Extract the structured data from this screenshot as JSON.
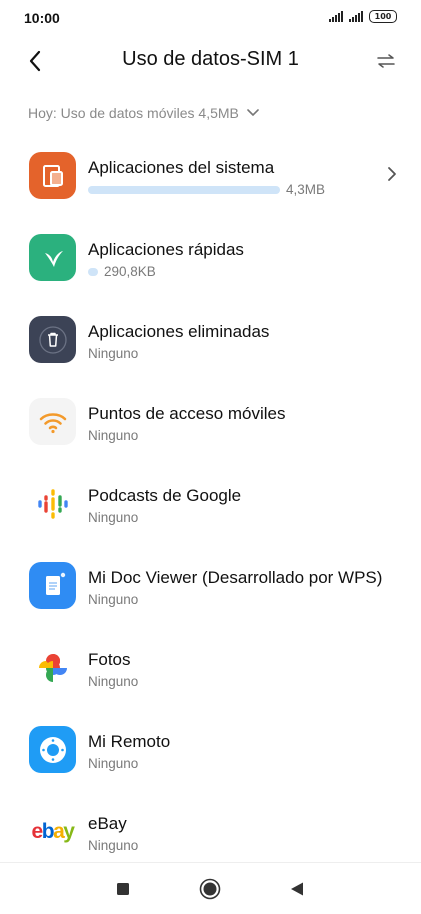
{
  "status_bar": {
    "time": "10:00",
    "battery": "100",
    "icons": [
      "signal-icon",
      "signal-icon",
      "battery-icon"
    ]
  },
  "header": {
    "title": "Uso de datos-SIM 1",
    "back_icon": "back-arrow-icon",
    "switch_icon": "switch-sim-icon"
  },
  "summary": {
    "text": "Hoy: Uso de datos móviles 4,5MB",
    "icon": "chevron-down-icon"
  },
  "apps": [
    {
      "name": "Aplicaciones del sistema",
      "usage": "4,3MB",
      "usage_fraction": 0.96,
      "icon": "system-apps-icon",
      "has_chevron": true
    },
    {
      "name": "Aplicaciones rápidas",
      "usage": "290,8KB",
      "usage_fraction": 0.06,
      "icon": "quick-apps-icon"
    },
    {
      "name": "Aplicaciones eliminadas",
      "usage": "Ninguno",
      "icon": "deleted-apps-icon"
    },
    {
      "name": "Puntos de acceso móviles",
      "usage": "Ninguno",
      "icon": "wifi-hotspot-icon"
    },
    {
      "name": "Podcasts de Google",
      "usage": "Ninguno",
      "icon": "google-podcasts-icon"
    },
    {
      "name": "Mi Doc Viewer (Desarrollado por WPS)",
      "usage": "Ninguno",
      "icon": "doc-viewer-icon"
    },
    {
      "name": "Fotos",
      "usage": "Ninguno",
      "icon": "google-photos-icon"
    },
    {
      "name": "Mi Remoto",
      "usage": "Ninguno",
      "icon": "mi-remote-icon"
    },
    {
      "name": "eBay",
      "usage": "Ninguno",
      "icon": "ebay-icon",
      "icon_text": "ebay"
    }
  ],
  "nav_bar": {
    "icons": [
      "recents-square-icon",
      "home-circle-icon",
      "back-triangle-icon"
    ]
  }
}
